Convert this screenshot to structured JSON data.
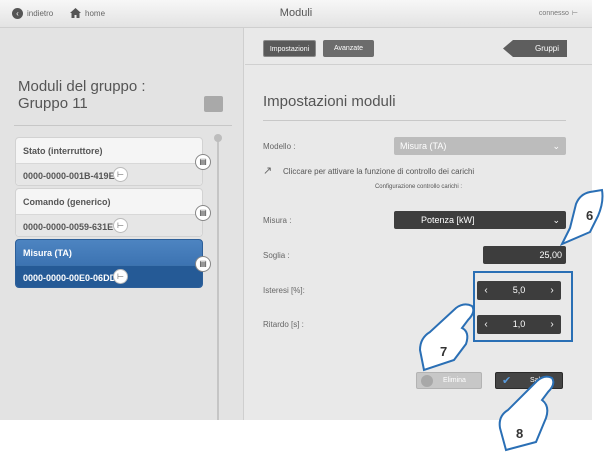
{
  "topbar": {
    "back_icon": "chevron-left-icon",
    "back_label": "indietro",
    "home_icon": "home-icon",
    "home_label": "home",
    "title": "Moduli",
    "status": "connesso",
    "status_icon": "usb-icon"
  },
  "left": {
    "group_title_line1": "Moduli del gruppo :",
    "group_title_line2": "Gruppo 11",
    "devices": [
      {
        "name": "Stato (interruttore)",
        "id": "0000-0000-001B-419E",
        "selected": false
      },
      {
        "name": "Comando (generico)",
        "id": "0000-0000-0059-631E",
        "selected": false
      },
      {
        "name": "Misura (TA)",
        "id": "0000-0000-00E0-06DD",
        "selected": true
      }
    ]
  },
  "tabs": {
    "impostazioni": "Impostazioni",
    "avanzate": "Avanzate",
    "gruppi": "Gruppi"
  },
  "settings": {
    "heading": "Impostazioni moduli",
    "modello_label": "Modello :",
    "modello_value": "Misura (TA)",
    "control_text": "Cliccare per attivare la funzione di controllo dei carichi",
    "control_sub": "Configurazione controllo carichi :",
    "misura_label": "Misura :",
    "misura_value": "Potenza [kW]",
    "soglia_label": "Soglia :",
    "soglia_value": "25,00",
    "isteresi_label": "Isteresi [%]:",
    "isteresi_value": "5,0",
    "ritardo_label": "Ritardo [s] :",
    "ritardo_value": "1,0",
    "delete_label": "Elimina",
    "save_label": "Salva"
  },
  "annotations": {
    "six": "6",
    "seven": "7",
    "eight": "8",
    "accent": "#2a6fb5"
  }
}
